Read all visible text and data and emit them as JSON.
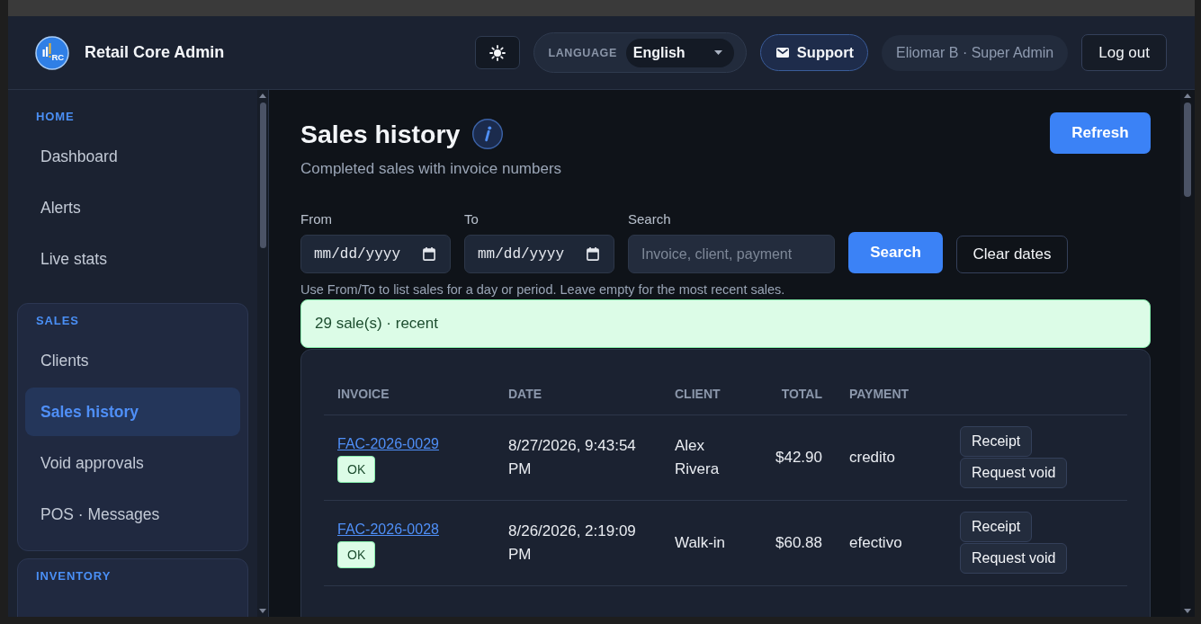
{
  "header": {
    "logo_text": "RC",
    "app_name": "Retail Core Admin",
    "language": {
      "label": "LANGUAGE",
      "value": "English"
    },
    "support": "Support",
    "user": "Eliomar B · Super Admin",
    "logout": "Log out"
  },
  "sidebar": {
    "sections": [
      {
        "title": "HOME",
        "kind": "plain",
        "items": [
          {
            "label": "Dashboard",
            "selected": false
          },
          {
            "label": "Alerts",
            "selected": false
          },
          {
            "label": "Live stats",
            "selected": false
          }
        ]
      },
      {
        "title": "SALES",
        "kind": "card",
        "items": [
          {
            "label": "Clients",
            "selected": false
          },
          {
            "label": "Sales history",
            "selected": true
          },
          {
            "label": "Void approvals",
            "selected": false
          },
          {
            "label": "POS · Messages",
            "selected": false
          }
        ]
      },
      {
        "title": "INVENTORY",
        "kind": "card"
      }
    ]
  },
  "page": {
    "title": "Sales history",
    "subtitle": "Completed sales with invoice numbers",
    "refresh": "Refresh"
  },
  "filters": {
    "fields": [
      {
        "kind": "date",
        "label": "From",
        "placeholder": "mm/dd/yyyy"
      },
      {
        "kind": "date",
        "label": "To",
        "placeholder": "mm/dd/yyyy"
      },
      {
        "kind": "text",
        "label": "Search",
        "placeholder": "Invoice, client, payment"
      }
    ],
    "search_button": "Search",
    "clear_button": "Clear dates",
    "hint": "Use From/To to list sales for a day or period. Leave empty for the most recent sales."
  },
  "status": "29 sale(s) · recent",
  "table": {
    "columns": [
      "INVOICE",
      "DATE",
      "CLIENT",
      "TOTAL",
      "PAYMENT"
    ],
    "rows": [
      {
        "invoice": "FAC-2026-0029",
        "badge": "OK",
        "date": "8/27/2026, 9:43:54 PM",
        "client": "Alex Rivera",
        "total": "$42.90",
        "payment": "credito",
        "actions": [
          "Receipt",
          "Request void"
        ]
      },
      {
        "invoice": "FAC-2026-0028",
        "badge": "OK",
        "date": "8/26/2026, 2:19:09 PM",
        "client": "Walk-in",
        "total": "$60.88",
        "payment": "efectivo",
        "actions": [
          "Receipt",
          "Request void"
        ]
      }
    ]
  }
}
